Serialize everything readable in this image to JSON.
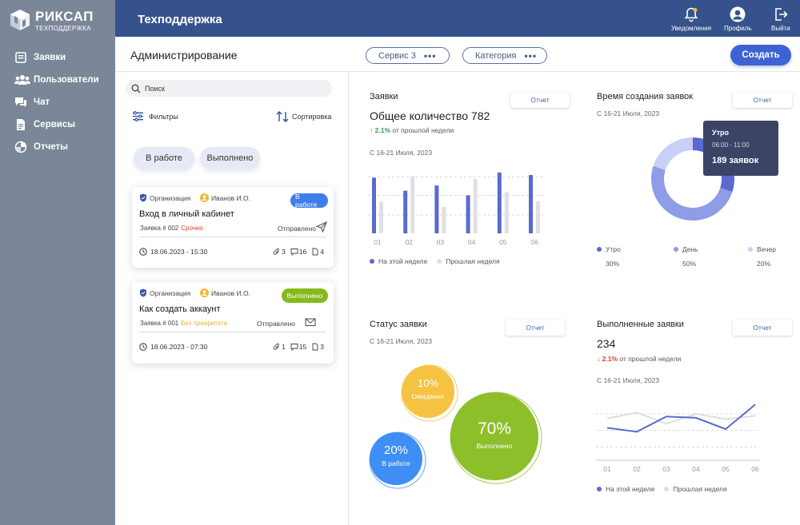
{
  "brand": {
    "name": "РИКСАП",
    "subtitle": "ТЕХПОДДЕРЖКА"
  },
  "nav": [
    {
      "icon": "requests-icon",
      "label": "Заявки"
    },
    {
      "icon": "users-icon",
      "label": "Пользователи"
    },
    {
      "icon": "chat-icon",
      "label": "Чат"
    },
    {
      "icon": "services-icon",
      "label": "Сервисы"
    },
    {
      "icon": "reports-icon",
      "label": "Отчеты"
    }
  ],
  "topbar": {
    "title": "Техподдержка",
    "notifications_label": "Уведомления",
    "profile_label": "Профиль",
    "logout_label": "Выйти"
  },
  "header": {
    "title": "Администрирование",
    "service_filter": "Сервис 3",
    "category_filter": "Категория",
    "create_label": "Создать"
  },
  "left": {
    "search_placeholder": "Поиск",
    "filters_label": "Фильтры",
    "sort_label": "Сортировка",
    "tabs": [
      "В работе",
      "Выполнено"
    ]
  },
  "tickets": [
    {
      "org": "Организация",
      "user": "Иванов И.О.",
      "status": "В работе",
      "status_color": "#3d7ee8",
      "title": "Вход в личный кабинет",
      "number": "Заявка # 002",
      "priority": "Срочно",
      "priority_color": "#e0403a",
      "sent": "Отправлено",
      "date": "18.06.2023 - 15:30",
      "attachments": "3",
      "comments": "16",
      "docs": "4"
    },
    {
      "org": "Организация",
      "user": "Иванов И.О.",
      "status": "Выполнено",
      "status_color": "#86b91a",
      "title": "Как создать аккаунт",
      "number": "Заявка # 001",
      "priority": "Без приоритета",
      "priority_color": "#e8b23a",
      "sent": "Отправлено",
      "date": "18.06.2023 - 07:30",
      "attachments": "1",
      "comments": "15",
      "docs": "3"
    }
  ],
  "cards": {
    "requests": {
      "label": "Заявки",
      "report": "Отчет",
      "total": "Общее количество 782",
      "delta": "2.1%",
      "delta_text": "от прошлой недели",
      "period": "С 16-21 Июля, 2023"
    },
    "creation_time": {
      "label": "Время создания заявок",
      "report": "Отчет",
      "period": "С 16-21 Июля, 2023",
      "tooltip": {
        "title": "Утро",
        "range": "06:00 - 11:00",
        "value": "189 заявок"
      }
    },
    "status": {
      "label": "Статус заявки",
      "report": "Отчет",
      "period": "С 16-21 Июля, 2023"
    },
    "completed": {
      "label": "Выполненные заявки",
      "report": "Отчет",
      "total": "234",
      "delta": "2.1%",
      "delta_text": "от прошлой недели",
      "period": "С 16-21 Июля, 2023"
    }
  },
  "colors": {
    "accent": "#3d62d4",
    "series_current": "#5a6acf",
    "series_previous": "#e0e0e4",
    "morning": "#5a6acf",
    "day": "#8f9ce6",
    "evening": "#c9cff7"
  },
  "chart_data": [
    {
      "type": "bar",
      "categories": [
        "01",
        "02",
        "03",
        "04",
        "05",
        "06"
      ],
      "series": [
        {
          "name": "На этой неделе",
          "values": [
            8.5,
            6.5,
            7.3,
            5.8,
            9.3,
            8.9
          ]
        },
        {
          "name": "Прошлая неделя",
          "values": [
            4.8,
            8.7,
            4.0,
            8.3,
            6.3,
            4.9
          ]
        }
      ],
      "ylim": [
        0,
        10
      ],
      "grid": true,
      "legend": "bottom"
    },
    {
      "type": "pie",
      "categories": [
        "Утро",
        "День",
        "Вечер"
      ],
      "values": [
        30,
        50,
        20
      ],
      "labels": [
        "30%",
        "50%",
        "20%"
      ],
      "legend": "bottom"
    },
    {
      "type": "scatter",
      "categories": [
        "В работе",
        "Ожидание",
        "Выполнено"
      ],
      "values": [
        20,
        10,
        70
      ],
      "labels": [
        "20%",
        "10%",
        "70%"
      ],
      "colors": [
        "#3f8ef5",
        "#f5c242",
        "#8cbf2a"
      ]
    },
    {
      "type": "line",
      "categories": [
        "01",
        "02",
        "03",
        "04",
        "05",
        "06"
      ],
      "series": [
        {
          "name": "На этой неделе",
          "values": [
            4.9,
            4.3,
            6.6,
            6.4,
            4.7,
            8.4
          ]
        },
        {
          "name": "Прошлая неделя",
          "values": [
            6.3,
            7.2,
            5.5,
            7.0,
            6.2,
            6.7
          ]
        }
      ],
      "ylim": [
        0,
        10
      ],
      "grid": true,
      "legend": "bottom"
    }
  ]
}
